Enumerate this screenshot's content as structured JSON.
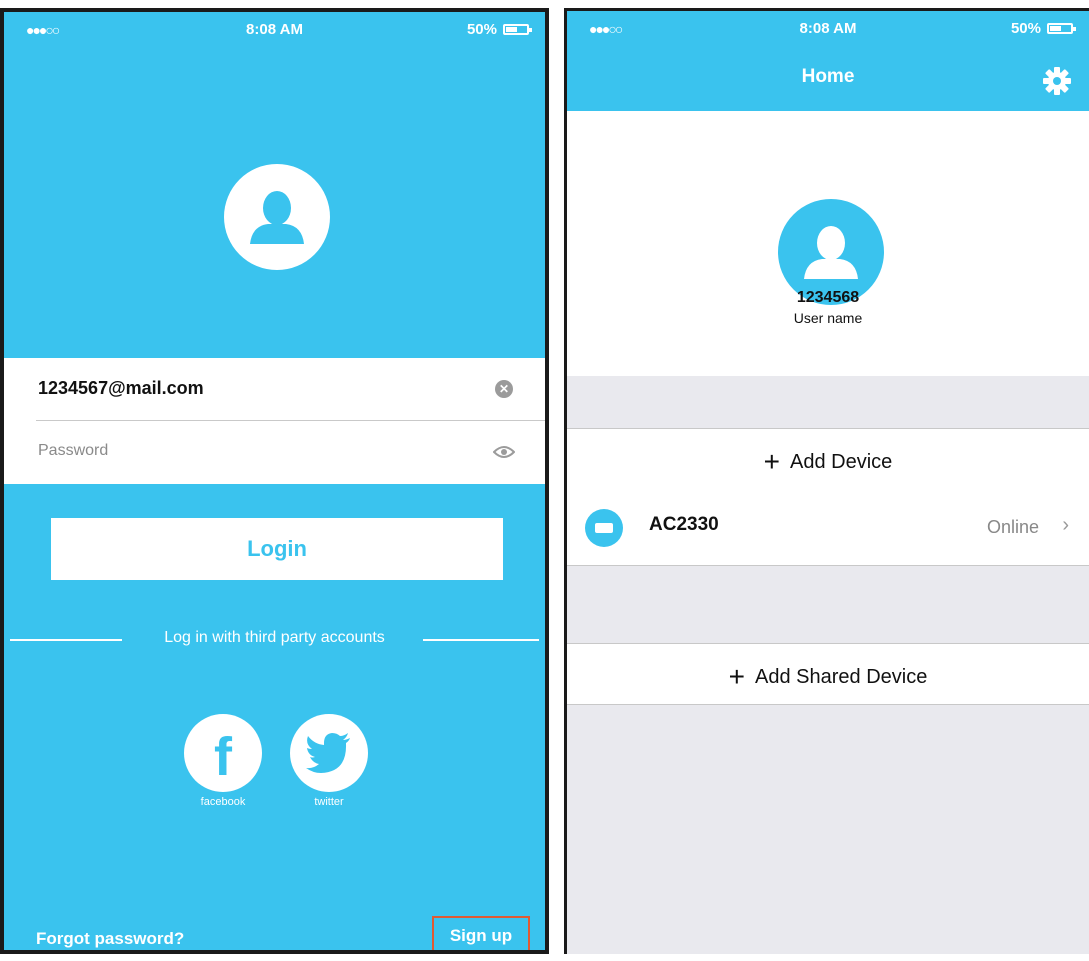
{
  "login_screen": {
    "status": {
      "signal": "●●●○○",
      "time": "8:08 AM",
      "battery": "50%"
    },
    "email_value": "1234567@mail.com",
    "password_placeholder": "Password",
    "login_label": "Login",
    "third_party_label": "Log in with third party accounts",
    "social": [
      {
        "label": "facebook",
        "glyph": "f",
        "icon": "facebook-icon"
      },
      {
        "label": "twitter",
        "icon": "twitter-icon"
      }
    ],
    "forgot_label": "Forgot password?",
    "signup_label": "Sign up",
    "colors": {
      "brand": "#3ac3ee",
      "highlight": "#e05a33"
    }
  },
  "home_screen": {
    "status": {
      "signal": "●●●○○",
      "time": "8:08 AM",
      "battery": "50%"
    },
    "title": "Home",
    "user_id": "1234568",
    "user_name": "User name",
    "add_device_label": "Add Device",
    "device": {
      "name": "AC2330",
      "status": "Online",
      "icon": "air-conditioner-icon"
    },
    "add_shared_label": "Add Shared Device"
  }
}
